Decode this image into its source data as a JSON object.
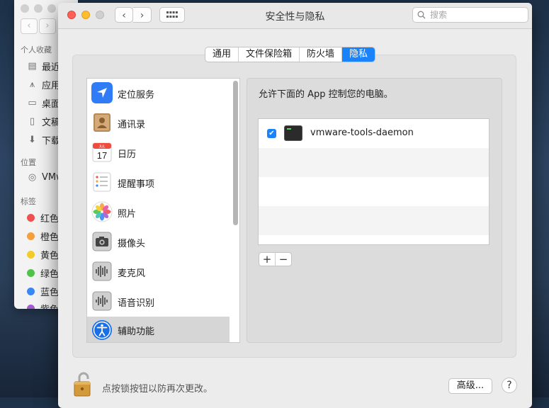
{
  "finder": {
    "sections": {
      "favorites": "个人收藏",
      "locations": "位置",
      "tags": "标签"
    },
    "favorites": [
      "最近",
      "应用",
      "桌面",
      "文稿",
      "下载"
    ],
    "locations": [
      "VMw"
    ],
    "tags": [
      {
        "label": "红色",
        "color": "#f0504e"
      },
      {
        "label": "橙色",
        "color": "#f5a03a"
      },
      {
        "label": "黄色",
        "color": "#f3cc2a"
      },
      {
        "label": "绿色",
        "color": "#4fc34a"
      },
      {
        "label": "蓝色",
        "color": "#3a87f5"
      },
      {
        "label": "紫色",
        "color": "#a55ad0"
      }
    ]
  },
  "window": {
    "title": "安全性与隐私",
    "search_placeholder": "搜索",
    "grid_icon": "grid-icon",
    "nav_back": "‹",
    "nav_forward": "›"
  },
  "tabs": [
    {
      "label": "通用",
      "active": false
    },
    {
      "label": "文件保险箱",
      "active": false
    },
    {
      "label": "防火墙",
      "active": false
    },
    {
      "label": "隐私",
      "active": true
    }
  ],
  "privacy_list": [
    {
      "label": "定位服务",
      "icon": "location-icon"
    },
    {
      "label": "通讯录",
      "icon": "contacts-icon"
    },
    {
      "label": "日历",
      "icon": "calendar-icon",
      "day": "17",
      "month": "JUL"
    },
    {
      "label": "提醒事项",
      "icon": "reminders-icon"
    },
    {
      "label": "照片",
      "icon": "photos-icon"
    },
    {
      "label": "摄像头",
      "icon": "camera-icon"
    },
    {
      "label": "麦克风",
      "icon": "microphone-icon"
    },
    {
      "label": "语音识别",
      "icon": "speech-recognition-icon"
    },
    {
      "label": "辅助功能",
      "icon": "accessibility-icon",
      "selected": true
    }
  ],
  "right_pane": {
    "description": "允许下面的 App 控制您的电脑。",
    "apps": [
      {
        "name": "vmware-tools-daemon",
        "checked": true
      }
    ],
    "add_label": "+",
    "remove_label": "−"
  },
  "footer": {
    "lock_text": "点按锁按钮以防再次更改。",
    "advanced_label": "高级...",
    "help_label": "?"
  },
  "colors": {
    "accent": "#1a82fb",
    "close": "#fe5f57",
    "minimize": "#febc2e"
  }
}
